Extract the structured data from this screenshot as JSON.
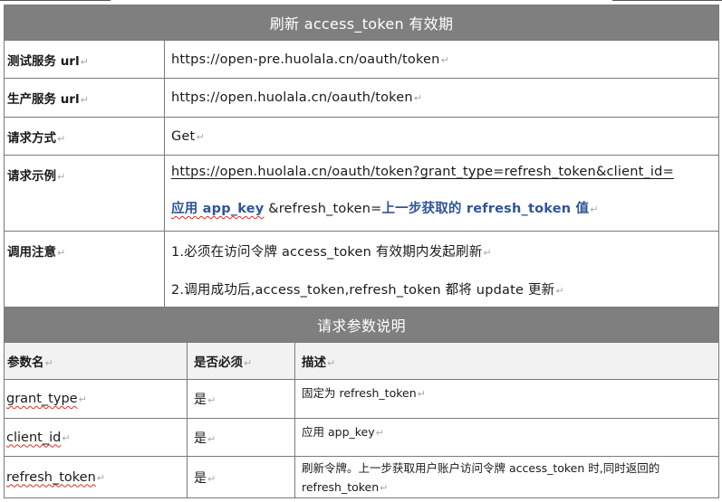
{
  "section1": {
    "header": "刷新 access_token 有效期",
    "rows": {
      "test_url": {
        "label": "测试服务 url",
        "value": "https://open-pre.huolala.cn/oauth/token"
      },
      "prod_url": {
        "label": "生产服务 url",
        "value": "https://open.huolala.cn/oauth/token"
      },
      "method": {
        "label": "请求方式",
        "value": "Get"
      },
      "example": {
        "label": "请求示例",
        "line1": "https://open.huolala.cn/oauth/token?grant_type=refresh_token&client_id=",
        "line2_prefix": "应用 app_key",
        "line2_mid": " &refresh_token=",
        "line2_suffix": "上一步获取的 refresh_token 值"
      },
      "notes": {
        "label": "调用注意",
        "line1": "1.必须在访问令牌 access_token 有效期内发起刷新",
        "line2": "2.调用成功后,access_token,refresh_token 都将 update 更新"
      }
    }
  },
  "section2": {
    "header": "请求参数说明",
    "columns": [
      "参数名",
      "是否必须",
      "描述"
    ],
    "params": [
      {
        "name": "grant_type",
        "required": "是",
        "desc": "固定为 refresh_token"
      },
      {
        "name": "client_id",
        "required": "是",
        "desc": "应用 app_key"
      },
      {
        "name": "refresh_token",
        "required": "是",
        "desc": "刷新令牌。上一步获取用户账户访问令牌 access_token 时,同时返回的 refresh_token"
      }
    ]
  },
  "colors": {
    "header_bg": "#7f7f7f",
    "param_header_bg": "#f2f2f2",
    "highlight_blue": "#2f5597",
    "spell_underline": "#d8301f"
  },
  "return_mark": "↵"
}
